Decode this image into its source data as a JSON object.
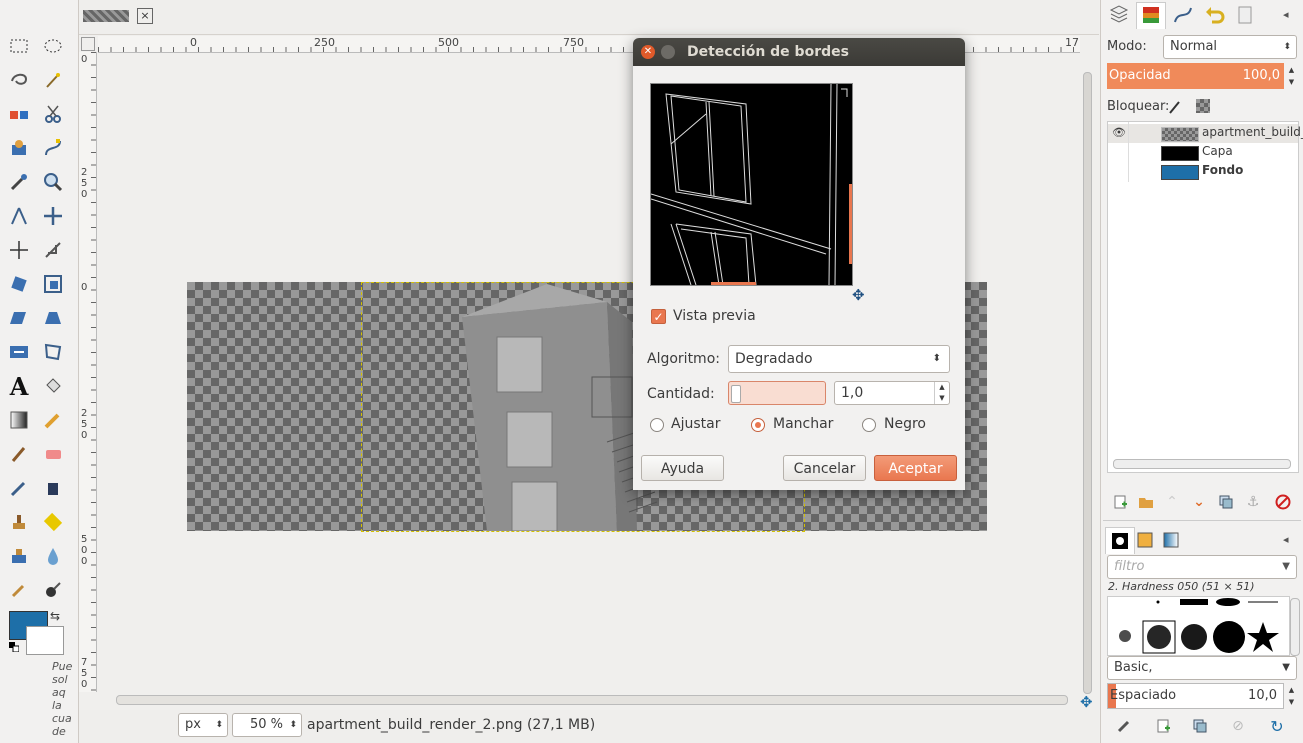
{
  "toolbox": {
    "hint_text": "Pue sol aq la cua de",
    "fg_color": "#1e6fa8",
    "bg_color": "#ffffff"
  },
  "image_window": {
    "tab_close": "×",
    "ruler_top_ticks": [
      "0",
      "250",
      "500",
      "750",
      "17"
    ],
    "ruler_left_ticks": [
      "0",
      "2\n5\n0",
      "0",
      "2\n5\n0",
      "5\n0\n0",
      "7\n5\n0"
    ],
    "status": {
      "unit": "px",
      "zoom": "50 %",
      "file_info": "apartment_build_render_2.png (27,1 MB)"
    }
  },
  "dialog": {
    "title": "Detección de bordes",
    "preview_label": "Vista previa",
    "preview_checked": true,
    "algorithm_label": "Algoritmo:",
    "algorithm_value": "Degradado",
    "amount_label": "Cantidad:",
    "amount_value": "1,0",
    "edge_options": [
      "Ajustar",
      "Manchar",
      "Negro"
    ],
    "edge_selected": "Manchar",
    "buttons": {
      "help": "Ayuda",
      "cancel": "Cancelar",
      "ok": "Aceptar"
    }
  },
  "dock": {
    "mode_label": "Modo:",
    "mode_value": "Normal",
    "opacity_label": "Opacidad",
    "opacity_value": "100,0",
    "lock_label": "Bloquear:",
    "layers": [
      {
        "name": "apartment_build_",
        "bold": false,
        "visible": true
      },
      {
        "name": "Capa",
        "bold": false,
        "visible": false
      },
      {
        "name": "Fondo",
        "bold": true,
        "visible": false
      }
    ],
    "brush_filter_placeholder": "filtro",
    "brush_name": "2. Hardness 050 (51 × 51)",
    "brush_tag": "Basic,",
    "spacing_label": "Espaciado",
    "spacing_value": "10,0"
  }
}
